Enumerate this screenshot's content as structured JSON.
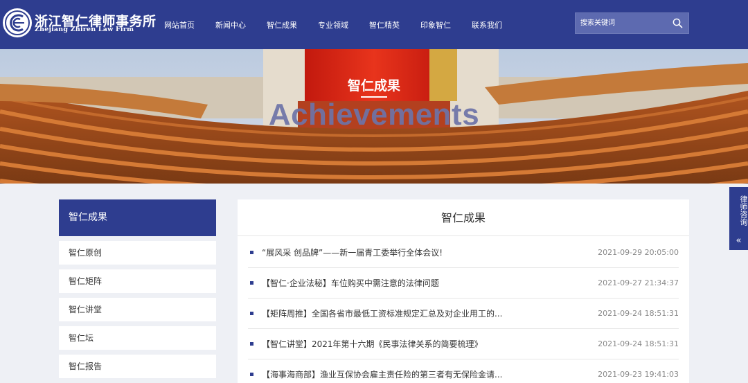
{
  "brand": {
    "name_cn": "浙江智仁律师事务所",
    "name_en": "Zhejiang Zhiren Law Firm",
    "logo_icon": "firm-logo-icon",
    "color_primary": "#2e3d8f"
  },
  "nav": {
    "items": [
      {
        "label": "网站首页"
      },
      {
        "label": "新闻中心"
      },
      {
        "label": "智仁成果"
      },
      {
        "label": "专业领域"
      },
      {
        "label": "智仁精英"
      },
      {
        "label": "印象智仁"
      },
      {
        "label": "联系我们"
      }
    ]
  },
  "search": {
    "placeholder": "搜索关键词",
    "icon": "search-icon"
  },
  "banner": {
    "title": "智仁成果",
    "subtitle": "Achievements"
  },
  "sidebar": {
    "title": "智仁成果",
    "items": [
      {
        "label": "智仁原创"
      },
      {
        "label": "智仁矩阵"
      },
      {
        "label": "智仁讲堂"
      },
      {
        "label": "智仁坛"
      },
      {
        "label": "智仁报告"
      }
    ]
  },
  "main": {
    "title": "智仁成果",
    "articles": [
      {
        "title": "“展风采 创品牌”——新一届青工委举行全体会议!",
        "date": "2021-09-29 20:05:00"
      },
      {
        "title": "【智仁·企业法秘】车位购买中需注意的法律问题",
        "date": "2021-09-27 21:34:37"
      },
      {
        "title": "【矩阵周推】全国各省市最低工资标准规定汇总及对企业用工的...",
        "date": "2021-09-24 18:51:31"
      },
      {
        "title": "【智仁讲堂】2021年第十六期《民事法律关系的简要梳理》",
        "date": "2021-09-24 18:51:31"
      },
      {
        "title": "【海事海商部】渔业互保协会雇主责任险的第三者有无保险金请...",
        "date": "2021-09-23 19:41:03"
      }
    ]
  },
  "consult": {
    "label": "律师咨询",
    "arrow": "«"
  }
}
